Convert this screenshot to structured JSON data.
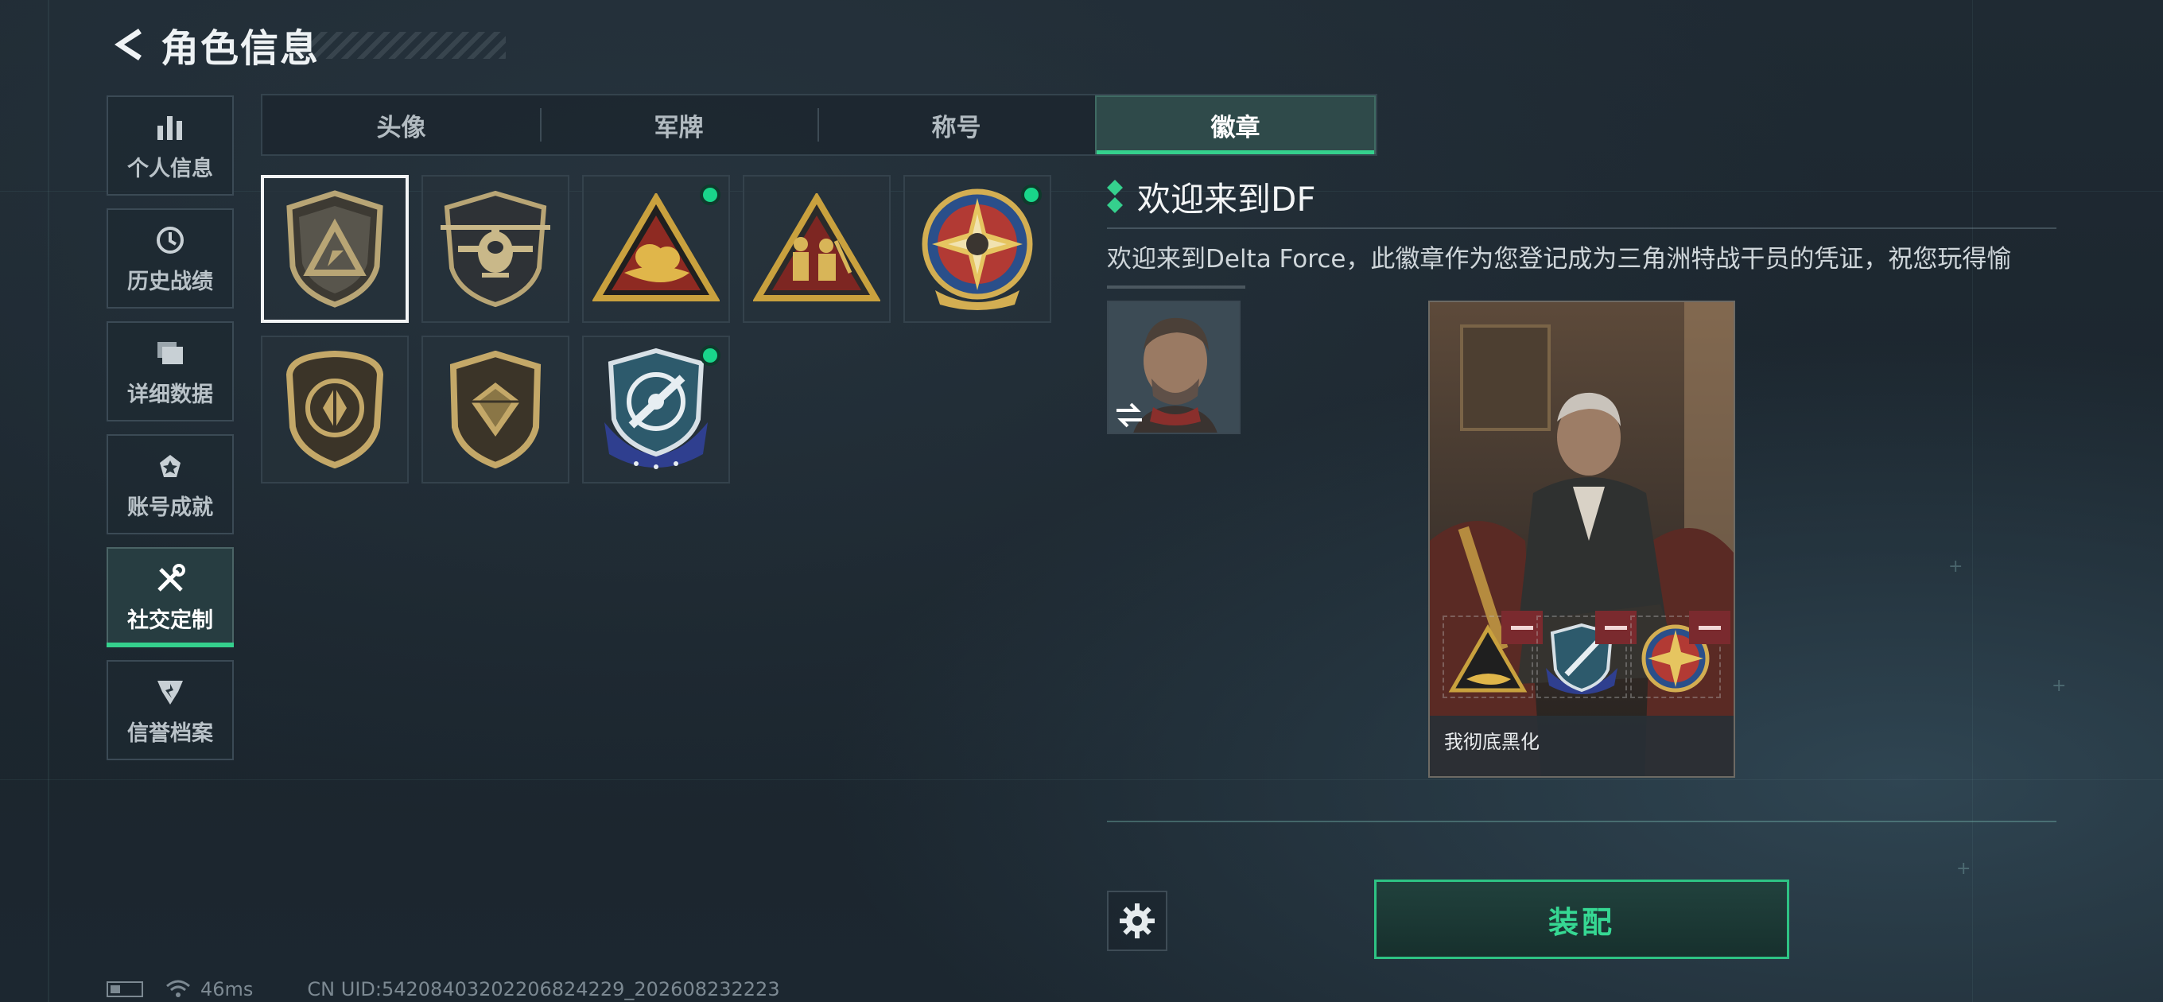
{
  "header": {
    "title": "角色信息"
  },
  "sidebar": {
    "items": [
      {
        "label": "个人信息",
        "icon": "bar-chart-icon",
        "active": false
      },
      {
        "label": "历史战绩",
        "icon": "history-clock-icon",
        "active": false
      },
      {
        "label": "详细数据",
        "icon": "folders-icon",
        "active": false
      },
      {
        "label": "账号成就",
        "icon": "achievement-medal-icon",
        "active": false
      },
      {
        "label": "社交定制",
        "icon": "tools-icon",
        "active": true
      },
      {
        "label": "信誉档案",
        "icon": "reputation-badge-icon",
        "active": false
      }
    ]
  },
  "tabs": [
    {
      "label": "头像",
      "active": false
    },
    {
      "label": "军牌",
      "active": false
    },
    {
      "label": "称号",
      "active": false
    },
    {
      "label": "徽章",
      "active": true
    }
  ],
  "badges": [
    {
      "name": "delta-shield-badge",
      "selected": true,
      "new": false
    },
    {
      "name": "helicopter-badge",
      "selected": false,
      "new": false
    },
    {
      "name": "golden-eagle-triangle-badge",
      "selected": false,
      "new": true
    },
    {
      "name": "soldiers-triangle-badge",
      "selected": false,
      "new": false
    },
    {
      "name": "star-compass-badge",
      "selected": false,
      "new": true
    },
    {
      "name": "bronze-crest-badge",
      "selected": false,
      "new": false
    },
    {
      "name": "diamond-crest-badge",
      "selected": false,
      "new": false
    },
    {
      "name": "blue-ribbon-badge",
      "selected": false,
      "new": true
    }
  ],
  "detail": {
    "title": "欢迎来到DF",
    "description": "欢迎来到Delta Force，此徽章作为您登记成为三角洲特战干员的凭证，祝您玩得愉"
  },
  "card": {
    "player_name": "我彻底黑化"
  },
  "actions": {
    "equip_label": "装配"
  },
  "status": {
    "ping": "46ms",
    "uid": "CN UID:54208403202206824229_202608232223"
  },
  "colors": {
    "accent": "#35d08d",
    "remove": "#7a2a2e"
  }
}
